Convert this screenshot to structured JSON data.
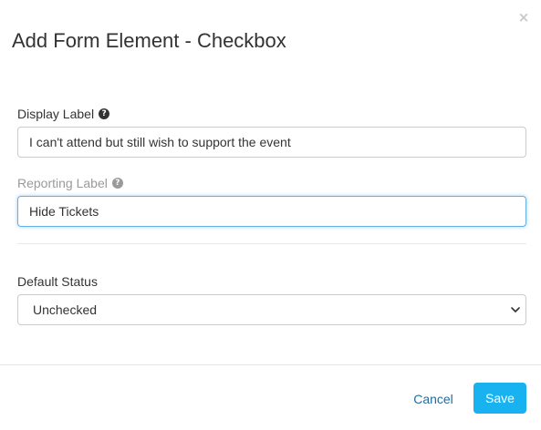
{
  "dialog": {
    "title": "Add Form Element - Checkbox",
    "close_symbol": "×"
  },
  "fields": {
    "display_label": {
      "label": "Display Label",
      "help_icon": "question-circle-icon",
      "value": "I can't attend but still wish to support the event"
    },
    "reporting_label": {
      "label": "Reporting Label",
      "help_icon": "question-circle-icon",
      "value": "Hide Tickets"
    },
    "default_status": {
      "label": "Default Status",
      "selected": "Unchecked"
    }
  },
  "footer": {
    "cancel_label": "Cancel",
    "save_label": "Save"
  },
  "colors": {
    "accent": "#19b2f0",
    "link": "#1f6e9e",
    "focus_border": "#66afe9"
  }
}
